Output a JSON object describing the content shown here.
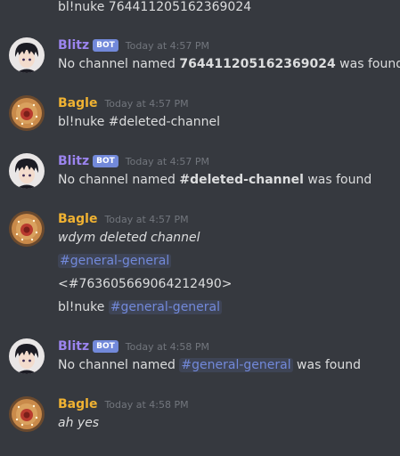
{
  "colors": {
    "background": "#36393f",
    "text": "#dcddde",
    "blitz_name": "#9b84ee",
    "bagle_name": "#f0b232",
    "timestamp": "#72767d",
    "bot_badge": "#7289da",
    "mention": "#7289da"
  },
  "top_message": {
    "text": "bl!nuke 764411205162369024"
  },
  "groups": [
    {
      "author": "Blitz",
      "bot_badge": "BOT",
      "timestamp": "Today at 4:57 PM",
      "avatar_icon": "dark-hair-character-avatar",
      "line": {
        "pre": "No channel named ",
        "bold": "764411205162369024",
        "post": " was found"
      }
    },
    {
      "author": "Bagle",
      "timestamp": "Today at 4:57 PM",
      "avatar_icon": "bagel-food-avatar",
      "line": {
        "text": "bl!nuke #deleted-channel"
      }
    },
    {
      "author": "Blitz",
      "bot_badge": "BOT",
      "timestamp": "Today at 4:57 PM",
      "avatar_icon": "dark-hair-character-avatar",
      "line": {
        "pre": "No channel named ",
        "bold": "#deleted-channel",
        "post": " was found"
      }
    },
    {
      "author": "Bagle",
      "timestamp": "Today at 4:57 PM",
      "avatar_icon": "bagel-food-avatar",
      "lines": {
        "l1": "wdym deleted channel",
        "l2_mention": "#general-general",
        "l3": "<#763605669064212490>",
        "l4_pre": "bl!nuke ",
        "l4_mention": "#general-general"
      }
    },
    {
      "author": "Blitz",
      "bot_badge": "BOT",
      "timestamp": "Today at 4:58 PM",
      "avatar_icon": "dark-hair-character-avatar",
      "line": {
        "pre": "No channel named ",
        "mention": "#general-general",
        "post": " was found"
      }
    },
    {
      "author": "Bagle",
      "timestamp": "Today at 4:58 PM",
      "avatar_icon": "bagel-food-avatar",
      "line": {
        "text": "ah yes"
      }
    }
  ]
}
